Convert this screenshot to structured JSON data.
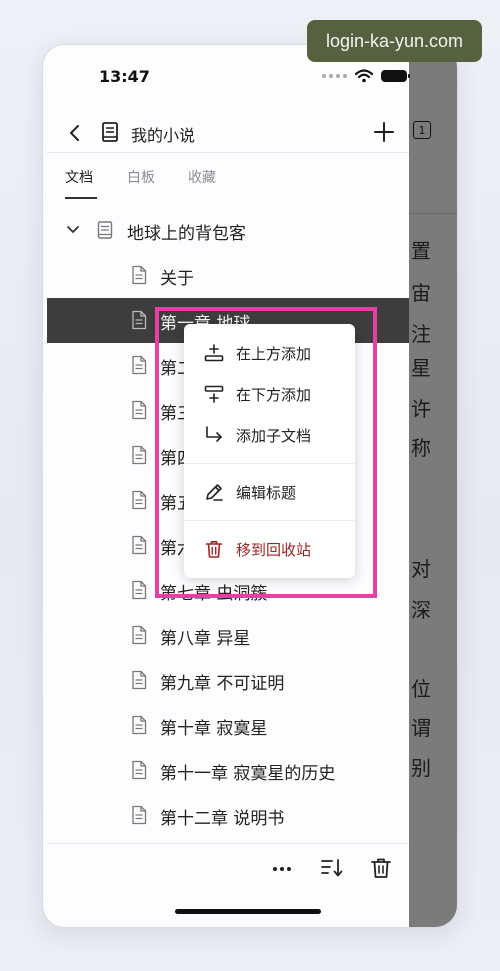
{
  "watermark": "login-ka-yun.com",
  "status": {
    "time": "13:47"
  },
  "header": {
    "title": "我的小说",
    "tab_count": "1"
  },
  "tabs": [
    {
      "label": "文档",
      "active": true
    },
    {
      "label": "白板",
      "active": false
    },
    {
      "label": "收藏",
      "active": false
    }
  ],
  "tree": {
    "root": {
      "label": "地球上的背包客",
      "icon": "book-icon"
    },
    "items": [
      {
        "label": "关于"
      },
      {
        "label": "第一章 地球",
        "selected": true
      },
      {
        "label": "第二章"
      },
      {
        "label": "第三章"
      },
      {
        "label": "第四章"
      },
      {
        "label": "第五章"
      },
      {
        "label": "第六章"
      },
      {
        "label": "第七章 虫洞簇"
      },
      {
        "label": "第八章 异星"
      },
      {
        "label": "第九章 不可证明"
      },
      {
        "label": "第十章 寂寞星"
      },
      {
        "label": "第十一章 寂寞星的历史"
      },
      {
        "label": "第十二章 说明书"
      }
    ]
  },
  "context_menu": {
    "items": [
      {
        "label": "在上方添加",
        "icon": "insert-above-icon"
      },
      {
        "label": "在下方添加",
        "icon": "insert-below-icon"
      },
      {
        "label": "添加子文档",
        "icon": "add-child-icon"
      },
      {
        "label": "编辑标题",
        "icon": "edit-icon"
      },
      {
        "label": "移到回收站",
        "icon": "trash-icon",
        "color": "#a32222"
      }
    ]
  },
  "right_panel_chars": [
    "置",
    "宙",
    "注",
    "星",
    "许",
    "称",
    "对",
    "深",
    "位",
    "谓",
    "别"
  ],
  "colors": {
    "selected_row": "#3d3d3d",
    "highlight": "#ea3ea7",
    "danger": "#a32222",
    "dim_panel": "#7b7b7b"
  }
}
